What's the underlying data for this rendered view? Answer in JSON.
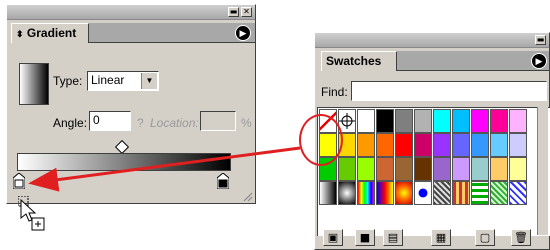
{
  "gradient_panel": {
    "tab_label": "Gradient",
    "type_label": "Type:",
    "type_value": "Linear",
    "angle_label": "Angle:",
    "angle_value": "0",
    "location_prefix": "?",
    "location_label": "Location:",
    "location_value": "",
    "location_unit": "%"
  },
  "swatches_panel": {
    "tab_label": "Swatches",
    "find_label": "Find:",
    "find_value": ""
  },
  "colors": {
    "highlight_circle": "#e02020",
    "arrow": "#e02020",
    "panel_bg": "#d4d0c8"
  },
  "swatch_rows": [
    [
      "none",
      "registration",
      "#ffffff",
      "#000000",
      "#7f7f7f",
      "#b2b2b2",
      "#00ffff",
      "#00bfff",
      "#ff00ff",
      "#ff0099",
      "#ffb3ff"
    ],
    [
      "#ffff00",
      "#ffd700",
      "#ff9900",
      "#ff6600",
      "#ff0000",
      "#cc0066",
      "#9933ff",
      "#6666ff",
      "#3399ff",
      "#66ccff",
      "#ccccff"
    ],
    [
      "#00cc00",
      "#66cc00",
      "#99ff00",
      "#cc6633",
      "#996633",
      "#663300",
      "#9966cc",
      "#cc99ff",
      "#99cccc",
      "#ffcc66",
      "#ffff99"
    ],
    [
      "gradient-bw",
      "gradient-radial",
      "gradient-rainbow",
      "gradient-spectrum",
      "gradient-orange",
      "pattern-dots",
      "pattern-stars",
      "pattern-blocks",
      "pattern-stripes",
      "pattern-green",
      "pattern-lattice"
    ]
  ],
  "swatch_buttons": [
    "show-all-swatches-icon",
    "show-color-swatches-icon",
    "show-gradient-swatches-icon",
    "show-pattern-swatches-icon",
    "new-swatch-icon",
    "delete-swatch-icon"
  ]
}
